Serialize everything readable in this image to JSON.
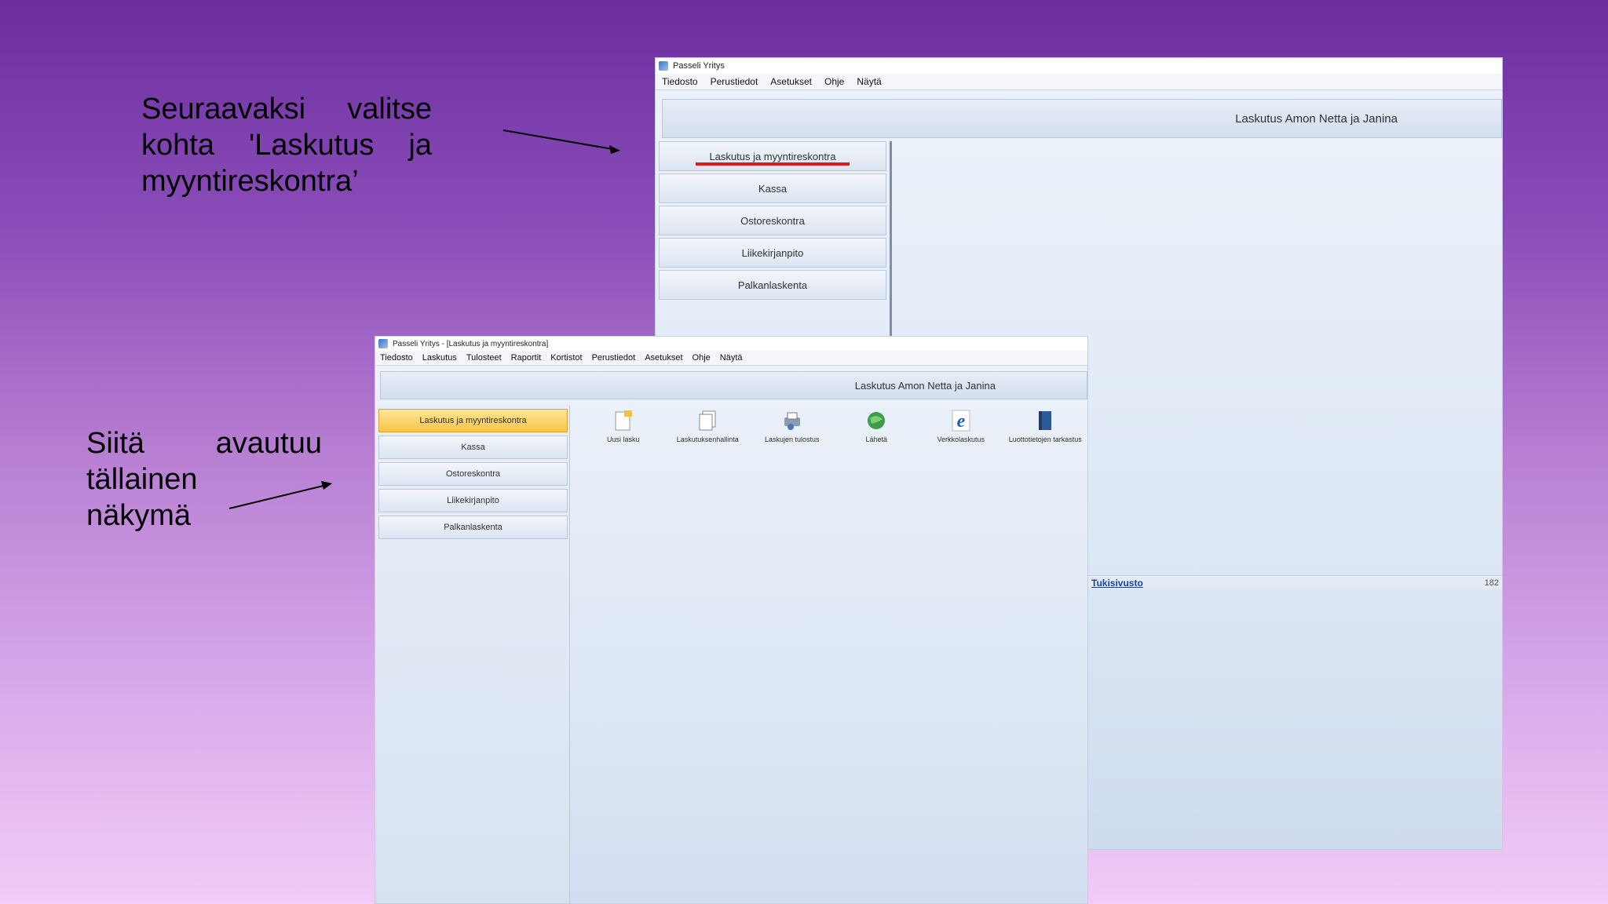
{
  "captions": {
    "top": {
      "lines": [
        [
          "Seuraavaksi",
          "valitse"
        ],
        [
          "kohta",
          "'Laskutus",
          "ja"
        ],
        [
          "myyntireskontra’"
        ]
      ]
    },
    "bottom": {
      "lines": [
        [
          "Siitä",
          "avautuu"
        ],
        [
          "tällainen"
        ],
        [
          "näkymä"
        ]
      ]
    }
  },
  "window1": {
    "title": "Passeli Yritys",
    "menu": [
      "Tiedosto",
      "Perustiedot",
      "Asetukset",
      "Ohje",
      "Näytä"
    ],
    "banner": "Laskutus Amon Netta ja Janina",
    "nav": [
      "Laskutus ja myyntireskontra",
      "Kassa",
      "Ostoreskontra",
      "Liikekirjanpito",
      "Palkanlaskenta"
    ],
    "status_link": "Tukisivusto",
    "status_number": "182"
  },
  "window2": {
    "title": "Passeli Yritys - [Laskutus ja myyntireskontra]",
    "menu": [
      "Tiedosto",
      "Laskutus",
      "Tulosteet",
      "Raportit",
      "Kortistot",
      "Perustiedot",
      "Asetukset",
      "Ohje",
      "Näytä"
    ],
    "banner": "Laskutus Amon Netta ja Janina",
    "nav": [
      "Laskutus ja myyntireskontra",
      "Kassa",
      "Ostoreskontra",
      "Liikekirjanpito",
      "Palkanlaskenta"
    ],
    "active_nav": "Laskutus ja myyntireskontra",
    "tools": [
      {
        "label": "Uusi lasku",
        "icon": "new-invoice-icon"
      },
      {
        "label": "Laskutuksenhallinta",
        "icon": "document-icon"
      },
      {
        "label": "Laskujen tulostus",
        "icon": "printer-icon"
      },
      {
        "label": "Lähetä",
        "icon": "globe-send-icon"
      },
      {
        "label": "Verkkolaskutus",
        "icon": "e-invoice-icon"
      },
      {
        "label": "Luottotietojen tarkastus",
        "icon": "book-icon"
      }
    ]
  },
  "colors": {
    "highlight": "#e01b1b",
    "active_nav": "#f7c444",
    "link": "#1a3fa8"
  }
}
